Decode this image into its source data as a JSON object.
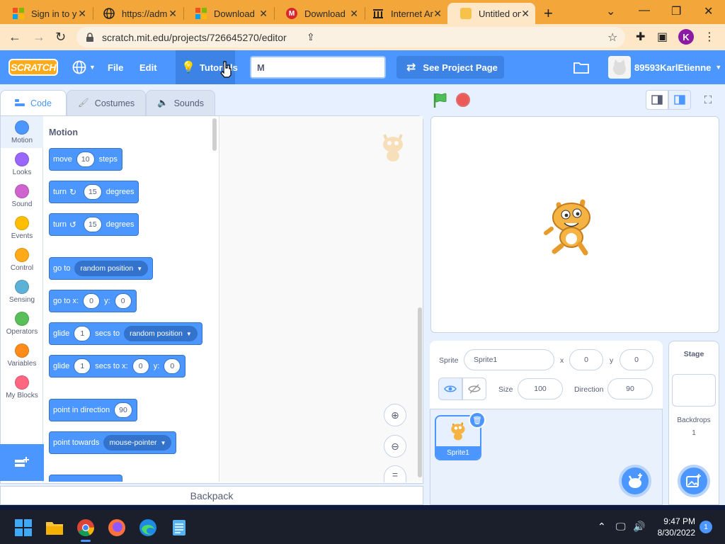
{
  "browser": {
    "tabs": [
      {
        "title": "Sign in to y",
        "icon": "microsoft-icon"
      },
      {
        "title": "https://adm",
        "icon": "globe-icon"
      },
      {
        "title": "Download",
        "icon": "microsoft-icon"
      },
      {
        "title": "Download",
        "icon": "mega-icon"
      },
      {
        "title": "Internet Ar",
        "icon": "archive-icon"
      },
      {
        "title": "Untitled on",
        "icon": "scratch-icon",
        "active": true
      }
    ],
    "url": "scratch.mit.edu/projects/726645270/editor",
    "profile_initial": "K"
  },
  "menubar": {
    "logo": "SCRATCH",
    "file": "File",
    "edit": "Edit",
    "tutorials": "Tutorials",
    "project_title": "M",
    "see_project": "See Project Page",
    "username": "89593KarlEtienne"
  },
  "editor_tabs": {
    "code": "Code",
    "costumes": "Costumes",
    "sounds": "Sounds"
  },
  "categories": [
    {
      "label": "Motion",
      "color": "#4c97ff"
    },
    {
      "label": "Looks",
      "color": "#9966ff"
    },
    {
      "label": "Sound",
      "color": "#cf63cf"
    },
    {
      "label": "Events",
      "color": "#ffbf00"
    },
    {
      "label": "Control",
      "color": "#ffab19"
    },
    {
      "label": "Sensing",
      "color": "#5cb1d6"
    },
    {
      "label": "Operators",
      "color": "#59c059"
    },
    {
      "label": "Variables",
      "color": "#ff8c1a"
    },
    {
      "label": "My Blocks",
      "color": "#ff6680"
    }
  ],
  "palette": {
    "section": "Motion",
    "move": {
      "a": "move",
      "v": "10",
      "b": "steps"
    },
    "turn_right": {
      "a": "turn",
      "v": "15",
      "b": "degrees"
    },
    "turn_left": {
      "a": "turn",
      "v": "15",
      "b": "degrees"
    },
    "goto": {
      "a": "go to",
      "dd": "random position"
    },
    "gotoxy": {
      "a": "go to x:",
      "x": "0",
      "b": "y:",
      "y": "0"
    },
    "glide": {
      "a": "glide",
      "v": "1",
      "b": "secs to",
      "dd": "random position"
    },
    "glidexy": {
      "a": "glide",
      "v": "1",
      "b": "secs to x:",
      "x": "0",
      "c": "y:",
      "y": "0"
    },
    "point_dir": {
      "a": "point in direction",
      "v": "90"
    },
    "point_towards": {
      "a": "point towards",
      "dd": "mouse-pointer"
    }
  },
  "backpack": "Backpack",
  "sprite_info": {
    "sprite_label": "Sprite",
    "sprite_name": "Sprite1",
    "x_label": "x",
    "x": "0",
    "y_label": "y",
    "y": "0",
    "show_label": "Show",
    "size_label": "Size",
    "size": "100",
    "direction_label": "Direction",
    "direction": "90"
  },
  "sprite_list": [
    {
      "name": "Sprite1"
    }
  ],
  "stage_pane": {
    "title": "Stage",
    "backdrops_label": "Backdrops",
    "backdrops": "1"
  },
  "taskbar": {
    "time": "9:47 PM",
    "date": "8/30/2022",
    "notifications": "1"
  }
}
